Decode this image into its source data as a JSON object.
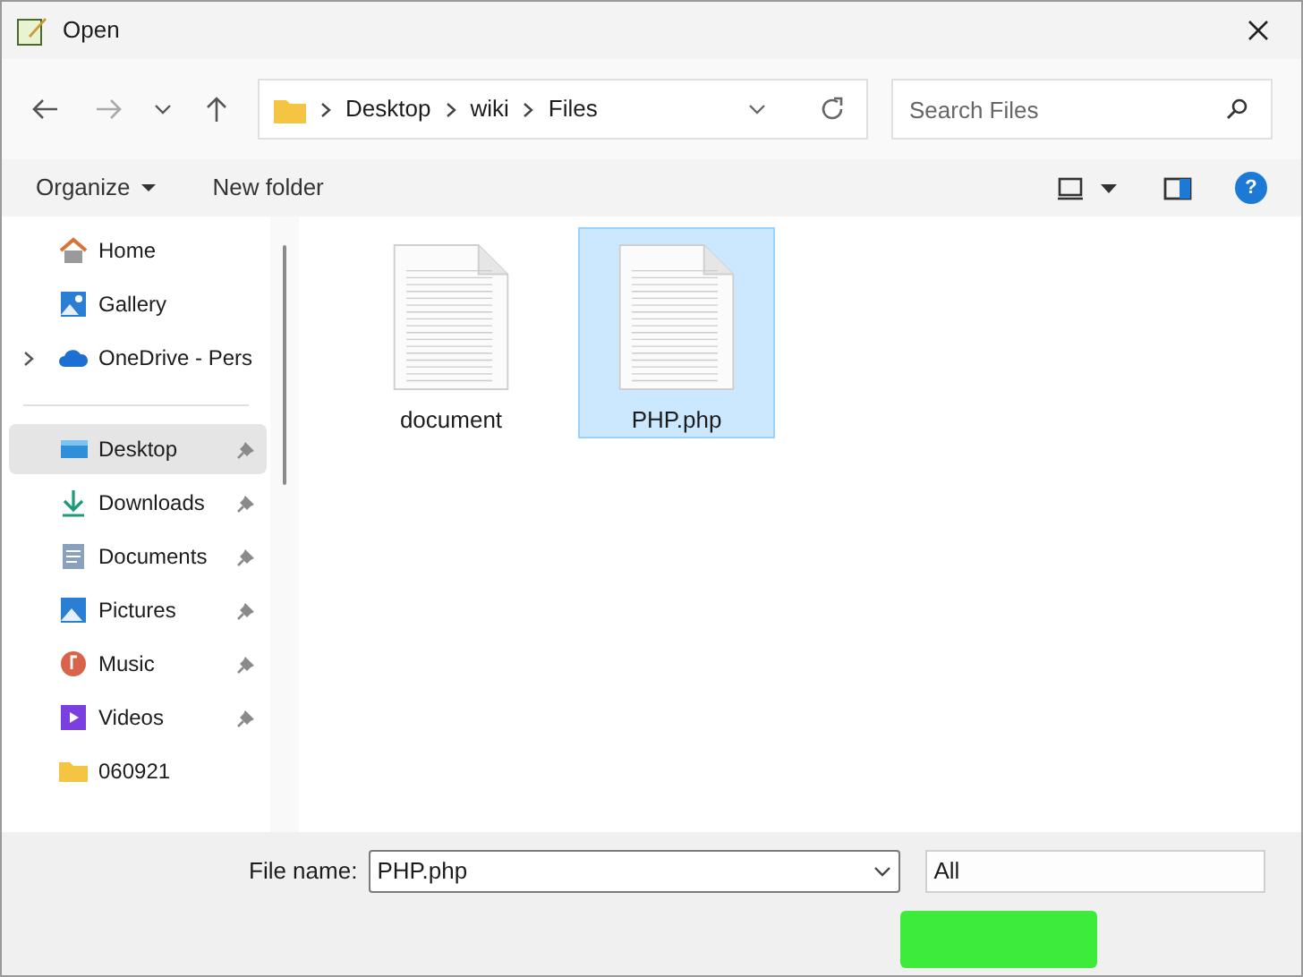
{
  "window": {
    "title": "Open"
  },
  "address_bar": {
    "path": [
      "Desktop",
      "wiki",
      "Files"
    ]
  },
  "search": {
    "placeholder": "Search Files"
  },
  "toolbar": {
    "organize": "Organize",
    "new_folder": "New folder",
    "help": "?"
  },
  "sidebar": {
    "items": [
      {
        "label": "Home",
        "pinned": false,
        "selected": false,
        "expandable": false
      },
      {
        "label": "Gallery",
        "pinned": false,
        "selected": false,
        "expandable": false
      },
      {
        "label": "OneDrive - Pers",
        "pinned": false,
        "selected": false,
        "expandable": true
      },
      {
        "label": "Desktop",
        "pinned": true,
        "selected": true,
        "expandable": false,
        "section_start": true
      },
      {
        "label": "Downloads",
        "pinned": true,
        "selected": false,
        "expandable": false
      },
      {
        "label": "Documents",
        "pinned": true,
        "selected": false,
        "expandable": false
      },
      {
        "label": "Pictures",
        "pinned": true,
        "selected": false,
        "expandable": false
      },
      {
        "label": "Music",
        "pinned": true,
        "selected": false,
        "expandable": false
      },
      {
        "label": "Videos",
        "pinned": true,
        "selected": false,
        "expandable": false
      },
      {
        "label": "060921",
        "pinned": false,
        "selected": false,
        "expandable": false
      }
    ]
  },
  "files": [
    {
      "name": "document",
      "selected": false
    },
    {
      "name": "PHP.php",
      "selected": true
    }
  ],
  "footer": {
    "file_name_label": "File name:",
    "file_name": "PHP.php",
    "file_type": "All"
  }
}
